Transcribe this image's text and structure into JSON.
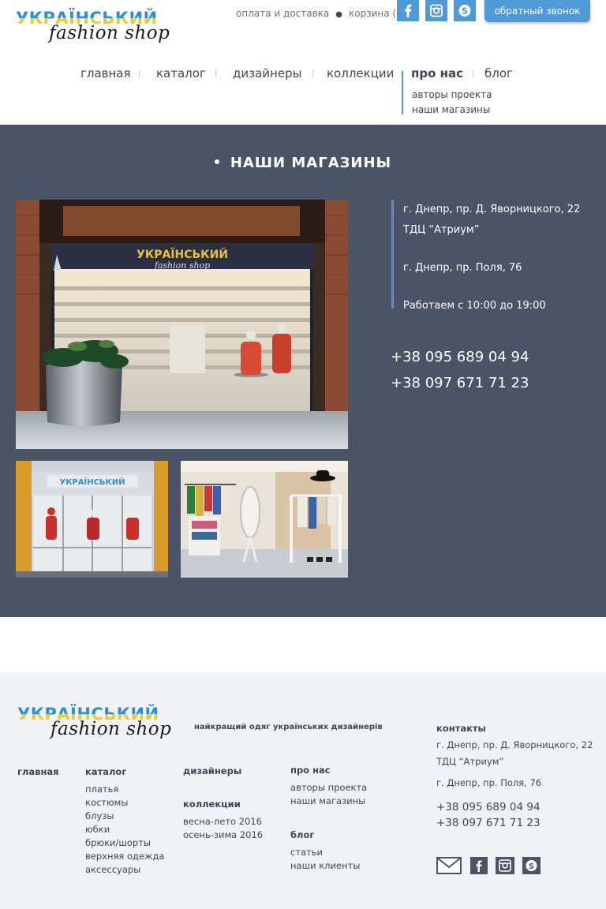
{
  "brand": {
    "logo_line1": "УКРАЇНСЬКИЙ",
    "logo_line2": "fashion shop",
    "tagline": "найкращий одяг українських дизайнерів"
  },
  "header": {
    "links": [
      "оплата и доставка",
      "корзина (0)"
    ],
    "social": [
      "facebook-icon",
      "instagram-icon",
      "skype-icon"
    ],
    "callback_label": "обратный звонок"
  },
  "nav": {
    "items": [
      "главная",
      "каталог",
      "дизайнеры",
      "коллекции",
      "про нас",
      "блог"
    ],
    "active": "про нас",
    "submenu": [
      "авторы проекта",
      "наши магазины"
    ]
  },
  "main": {
    "title": "НАШИ МАГАЗИНЫ",
    "address_line1": "г. Днепр, пр. Д. Яворницкого, 22",
    "address_line2": "ТДЦ “Атриум”",
    "address2": "г. Днепр, пр. Поля, 76",
    "hours": "Работаем с 10:00 до 19:00",
    "phone1": "+38 095 689 04 94",
    "phone2": "+38 097 671 71 23",
    "photo_sign_line1": "УКРАЇНСЬКИЙ",
    "photo_sign_line2": "fashion shop"
  },
  "footer": {
    "main_link": "главная",
    "catalog": {
      "title": "каталог",
      "items": [
        "платья",
        "костюмы",
        "блузы",
        "юбки",
        "брюки/шорты",
        "верхняя одежда",
        "аксессуары"
      ]
    },
    "designers": "дизайнеры",
    "collections": {
      "title": "коллекции",
      "items": [
        "весна-лето 2016",
        "осень-зима 2016"
      ]
    },
    "about": {
      "title": "про нас",
      "items": [
        "авторы проекта",
        "наши магазины"
      ]
    },
    "blog": {
      "title": "блог",
      "items": [
        "статьи",
        "наши клиенты"
      ]
    },
    "contacts": {
      "title": "контакты",
      "address_line1": "г. Днепр, пр. Д. Яворницкого, 22",
      "address_line2": "ТДЦ “Атриум”",
      "address2": "г. Днепр, пр. Поля, 76",
      "phone1": "+38 095 689 04 94",
      "phone2": "+38 097 671 71 23"
    },
    "icons": [
      "mail-icon",
      "facebook-icon",
      "instagram-icon",
      "skype-icon"
    ]
  },
  "colors": {
    "accent": "#4f9ad6",
    "band": "#4b5366",
    "footer_bg": "#f1f2f5",
    "text": "#3e4556",
    "logo_blue": "#2b8fd6",
    "logo_yellow": "#f3cc19"
  }
}
